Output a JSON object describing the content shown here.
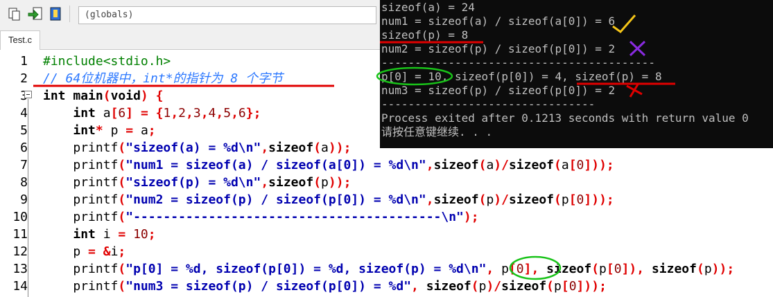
{
  "toolbar": {
    "globals_label": "(globals)",
    "icons": [
      "paste-icon",
      "insert-icon",
      "bookmark-icon",
      "combo-dropdown-icon"
    ]
  },
  "tabs": [
    {
      "label": "Test.c"
    }
  ],
  "editor": {
    "line_numbers": [
      "1",
      "2",
      "3",
      "4",
      "5",
      "6",
      "7",
      "8",
      "9",
      "10",
      "11",
      "12",
      "13",
      "14"
    ],
    "lines": [
      "#include<stdio.h>",
      "// 64位机器中，int*的指针为 8 个字节",
      "int main(void) {",
      "    int a[6] = {1,2,3,4,5,6};",
      "    int* p = a;",
      "    printf(\"sizeof(a) = %d\\n\",sizeof(a));",
      "    printf(\"num1 = sizeof(a) / sizeof(a[0]) = %d\\n\",sizeof(a)/sizeof(a[0]));",
      "    printf(\"sizeof(p) = %d\\n\",sizeof(p));",
      "    printf(\"num2 = sizeof(p) / sizeof(p[0]) = %d\\n\",sizeof(p)/sizeof(p[0]));",
      "    printf(\"-----------------------------------------\\n\");",
      "    int i = 10;",
      "    p = &i;",
      "    printf(\"p[0] = %d, sizeof(p[0]) = %d, sizeof(p) = %d\\n\", p[0], sizeof(p[0]), sizeof(p));",
      "    printf(\"num3 = sizeof(p) / sizeof(p[0]) = %d\", sizeof(p)/sizeof(p[0]));"
    ]
  },
  "console": {
    "lines": [
      "sizeof(a) = 24",
      "num1 = sizeof(a) / sizeof(a[0]) = 6",
      "sizeof(p) = 8",
      "num2 = sizeof(p) / sizeof(p[0]) = 2",
      "-----------------------------------------",
      "p[0] = 10, sizeof(p[0]) = 4, sizeof(p) = 8",
      "num3 = sizeof(p) / sizeof(p[0]) = 2",
      "--------------------------------",
      "Process exited after 0.1213 seconds with return value 0",
      "请按任意键继续. . ."
    ]
  },
  "colors": {
    "console_bg": "#0c0c0c",
    "console_text": "#c0c0c0",
    "annotation_red": "#e00000",
    "annotation_green": "#19c319",
    "check_yellow": "#f5c518",
    "cross_purple": "#8a2be2",
    "cross_red": "#e00000"
  }
}
